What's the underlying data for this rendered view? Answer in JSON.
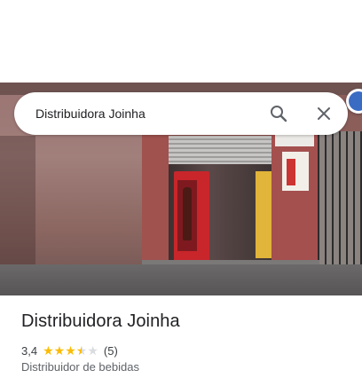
{
  "search": {
    "value": "Distribuidora Joinha"
  },
  "place": {
    "name": "Distribuidora Joinha",
    "rating": "3,4",
    "rating_value": 3.4,
    "stars_total": 5,
    "review_count": "(5)",
    "category": "Distribuidor de bebidas"
  },
  "icons": {
    "search": "search-icon",
    "close": "close-icon",
    "star": "star-icon"
  },
  "colors": {
    "star_filled": "#fbbc04",
    "star_empty": "#dadce0",
    "title_text": "#202124",
    "secondary_text": "#5f6368"
  }
}
